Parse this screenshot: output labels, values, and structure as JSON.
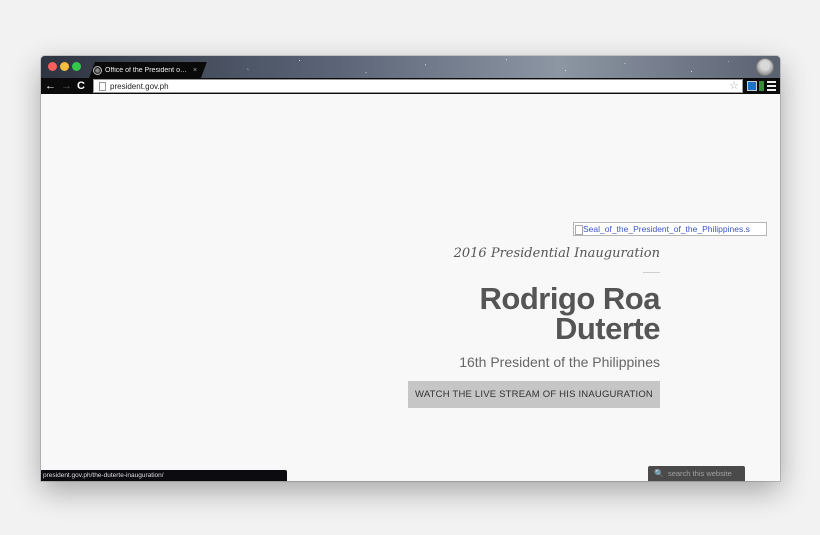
{
  "browser": {
    "tab_title": "Office of the President o…",
    "tab_close": "×",
    "url": "president.gov.ph",
    "status_url": "president.gov.ph/the-duterte-inauguration/"
  },
  "icons": {
    "back": "←",
    "forward": "→",
    "reload": "C",
    "star": "☆",
    "search": "🔍"
  },
  "page": {
    "seal_alt": "Seal_of_the_President_of_the_Philippines.s",
    "tagline": "2016 Presidential Inauguration",
    "name_line1": "Rodrigo Roa",
    "name_line2": "Duterte",
    "subtitle": "16th President of the Philippines",
    "cta_label": "WATCH THE LIVE STREAM OF HIS INAUGURATION"
  },
  "search": {
    "placeholder": "search this website"
  }
}
